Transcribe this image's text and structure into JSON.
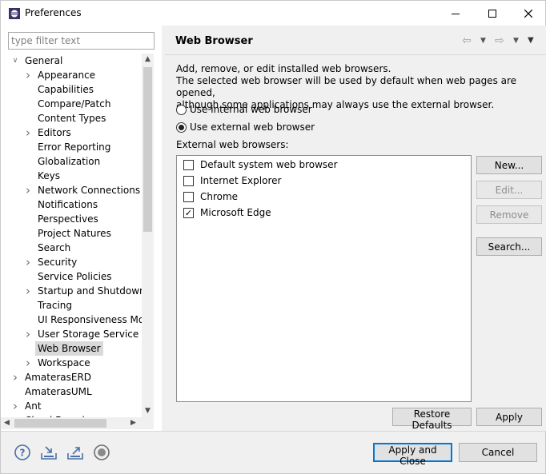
{
  "window": {
    "title": "Preferences"
  },
  "filter": {
    "placeholder": "type filter text"
  },
  "tree": [
    {
      "label": "General",
      "depth": 0,
      "arrow": "expanded"
    },
    {
      "label": "Appearance",
      "depth": 1,
      "arrow": "collapsed"
    },
    {
      "label": "Capabilities",
      "depth": 1,
      "arrow": ""
    },
    {
      "label": "Compare/Patch",
      "depth": 1,
      "arrow": ""
    },
    {
      "label": "Content Types",
      "depth": 1,
      "arrow": ""
    },
    {
      "label": "Editors",
      "depth": 1,
      "arrow": "collapsed"
    },
    {
      "label": "Error Reporting",
      "depth": 1,
      "arrow": ""
    },
    {
      "label": "Globalization",
      "depth": 1,
      "arrow": ""
    },
    {
      "label": "Keys",
      "depth": 1,
      "arrow": ""
    },
    {
      "label": "Network Connections",
      "depth": 1,
      "arrow": "collapsed"
    },
    {
      "label": "Notifications",
      "depth": 1,
      "arrow": ""
    },
    {
      "label": "Perspectives",
      "depth": 1,
      "arrow": ""
    },
    {
      "label": "Project Natures",
      "depth": 1,
      "arrow": ""
    },
    {
      "label": "Search",
      "depth": 1,
      "arrow": ""
    },
    {
      "label": "Security",
      "depth": 1,
      "arrow": "collapsed"
    },
    {
      "label": "Service Policies",
      "depth": 1,
      "arrow": ""
    },
    {
      "label": "Startup and Shutdown",
      "depth": 1,
      "arrow": "collapsed"
    },
    {
      "label": "Tracing",
      "depth": 1,
      "arrow": ""
    },
    {
      "label": "UI Responsiveness Moni",
      "depth": 1,
      "arrow": ""
    },
    {
      "label": "User Storage Service",
      "depth": 1,
      "arrow": "collapsed"
    },
    {
      "label": "Web Browser",
      "depth": 1,
      "arrow": "",
      "selected": true
    },
    {
      "label": "Workspace",
      "depth": 1,
      "arrow": "collapsed"
    },
    {
      "label": "AmaterasERD",
      "depth": 0,
      "arrow": "collapsed"
    },
    {
      "label": "AmaterasUML",
      "depth": 0,
      "arrow": ""
    },
    {
      "label": "Ant",
      "depth": 0,
      "arrow": "collapsed"
    },
    {
      "label": "Cloud Foundry",
      "depth": 0,
      "arrow": "collapsed"
    }
  ],
  "page": {
    "title": "Web Browser",
    "description": [
      "Add, remove, or edit installed web browsers.",
      "The selected web browser will be used by default when web pages are opened,",
      "although some applications may always use the external browser."
    ],
    "radio_internal": "Use internal web browser",
    "radio_external": "Use external web browser",
    "selected_radio": "external",
    "list_label": "External web browsers:",
    "browsers": [
      {
        "name": "Default system web browser",
        "checked": false
      },
      {
        "name": "Internet Explorer",
        "checked": false
      },
      {
        "name": "Chrome",
        "checked": false
      },
      {
        "name": "Microsoft Edge",
        "checked": true
      }
    ],
    "buttons": {
      "new": "New...",
      "edit": "Edit...",
      "remove": "Remove",
      "search": "Search..."
    },
    "restore_defaults": "Restore Defaults",
    "apply": "Apply"
  },
  "bottom": {
    "apply_close": "Apply and Close",
    "cancel": "Cancel"
  }
}
